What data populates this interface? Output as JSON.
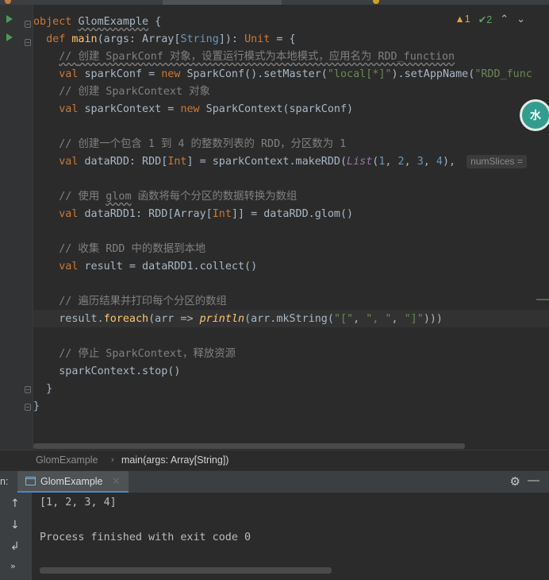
{
  "inspection": {
    "warnings": "1",
    "checks": "2"
  },
  "code": {
    "l1": {
      "kw": "object",
      "name": "GlomExample",
      "rest": " {"
    },
    "l2": {
      "kw": "def",
      "fn": "main",
      "a": "(args: Array[",
      "ty": "String",
      "b": "]): ",
      "ty2": "Unit",
      "c": " = {"
    },
    "l3": {
      "c1": "// ",
      "c2": "创建 SparkConf 对象，设置运行模式为本地模式，应用名为 RDD_function"
    },
    "l4": {
      "kw": "val",
      "a": " sparkConf = ",
      "kw2": "new",
      "b": " SparkConf().setMaster(",
      "s1": "\"local[*]\"",
      "c": ").setAppName(",
      "s2": "\"RDD_func"
    },
    "l5": {
      "c": "// 创建 SparkContext 对象"
    },
    "l6": {
      "kw": "val",
      "a": " sparkContext = ",
      "kw2": "new",
      "b": " SparkContext(sparkConf)"
    },
    "l7": {
      "c": "// 创建一个包含 1 到 4 的整数列表的 RDD，分区数为 1"
    },
    "l8": {
      "kw": "val",
      "a": " dataRDD: RDD[",
      "ty": "Int",
      "b": "] = sparkContext.makeRDD(",
      "it": "List",
      "c": "(",
      "n1": "1",
      "s1": ", ",
      "n2": "2",
      "s2": ", ",
      "n3": "3",
      "s3": ", ",
      "n4": "4",
      "d": "), ",
      "hint": "numSlices ="
    },
    "l9": {
      "c1": "// 使用 ",
      "c2": "glom",
      "c3": " 函数将每个分区的数据转换为数组"
    },
    "l10": {
      "kw": "val",
      "a": " dataRDD1: RDD[Array[",
      "ty": "Int",
      "b": "]] = dataRDD.glom()"
    },
    "l11": {
      "c": "// 收集 RDD 中的数据到本地"
    },
    "l12": {
      "kw": "val",
      "a": " result = dataRDD1.collect()"
    },
    "l13": {
      "c": "// 遍历结果并打印每个分区的数组"
    },
    "l14": {
      "a": "result.",
      "fn": "foreach",
      "b": "(arr => ",
      "it": "println",
      "c": "(arr.mkString(",
      "s1": "\"[\"",
      "d": ", ",
      "s2": "\", \"",
      "e": ", ",
      "s3": "\"]\"",
      "f": ")))"
    },
    "l15": {
      "c": "// 停止 SparkContext，释放资源"
    },
    "l16": {
      "a": "sparkContext.stop()"
    },
    "l17": {
      "a": "}"
    },
    "l18": {
      "a": "}"
    }
  },
  "breadcrumb": {
    "item1": "GlomExample",
    "item2": "main(args: Array[String])"
  },
  "run_panel": {
    "label": "n:",
    "tab_label": "GlomExample"
  },
  "console": {
    "line1": "[1, 2, 3, 4]",
    "line2": "Process finished with exit code 0"
  },
  "colors": {
    "accent": "#4a88c7",
    "keyword": "#cc7832",
    "string": "#6a8759",
    "number": "#6897bb",
    "comment": "#808080"
  }
}
